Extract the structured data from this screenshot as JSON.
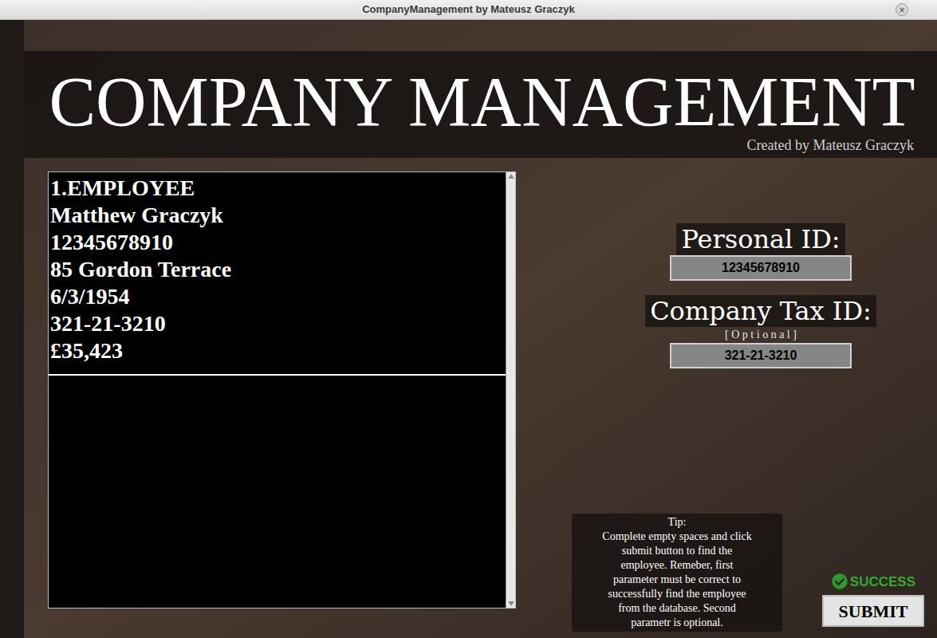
{
  "window": {
    "title": "CompanyManagement by Mateusz Graczyk",
    "close": "×"
  },
  "header": {
    "title": "COMPANY MANAGEMENT",
    "subtitle": "Created by Mateusz Graczyk"
  },
  "records": [
    {
      "lines": [
        "1.EMPLOYEE",
        "Matthew Graczyk",
        "12345678910",
        "85 Gordon Terrace",
        "6/3/1954",
        "321-21-3210",
        "£35,423"
      ]
    }
  ],
  "fields": [
    {
      "label": "Personal ID:",
      "note": "",
      "value": "12345678910"
    },
    {
      "label": "Company Tax ID:",
      "note": "[ O p t i o n a l ]",
      "value": "321-21-3210"
    }
  ],
  "tip": {
    "title": "Tip:",
    "lines": [
      "Complete empty spaces and click",
      "submit button to find the",
      "employee. Remeber, first",
      "parameter must be correct to",
      "successfully find the employee",
      "from the database. Second",
      "parametr is optional."
    ]
  },
  "status": {
    "text": "SUCCESS",
    "success": true
  },
  "button": "SUBMIT"
}
